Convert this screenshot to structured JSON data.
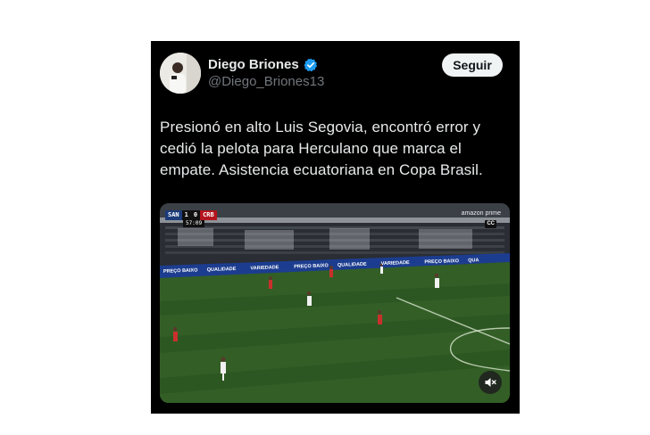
{
  "tweet": {
    "author": {
      "name": "Diego Briones",
      "handle": "@Diego_Briones13",
      "verified": true,
      "verified_color": "#1d9bf0"
    },
    "follow_label": "Seguir",
    "text": "Presionó en alto Luis Segovia, encontró error y cedió la pelota para Herculano que marca el empate. Asistencia ecuatoriana en Copa Brasil.",
    "media": {
      "scoreboard": {
        "home": "SAN",
        "home_score": "1",
        "away_score": "0",
        "away": "CRB",
        "clock": "57:09"
      },
      "broadcaster": "amazon prime",
      "cc_label": "CC",
      "mute_icon": "speaker-muted-icon",
      "ad_boards": [
        "PREÇO BAIXO",
        "QUALIDADE",
        "VARIEDADE",
        "PREÇO BAIXO",
        "QUALIDADE",
        "VARIEDADE",
        "PREÇO BAIXO",
        "QUA"
      ]
    }
  },
  "colors": {
    "card_background": "#000000",
    "primary_text": "#e7e9ea",
    "secondary_text": "#71767b",
    "follow_button": "#eff3f4",
    "pitch": "#2f5d25"
  }
}
